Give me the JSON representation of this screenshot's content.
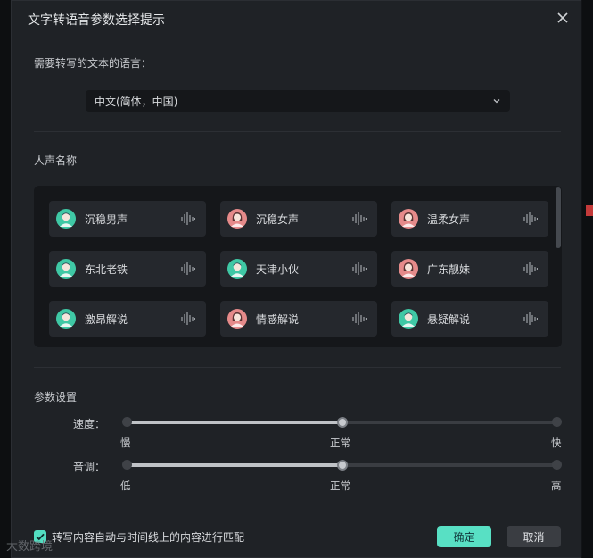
{
  "dialog": {
    "title": "文字转语音参数选择提示",
    "language_label": "需要转写的文本的语言：",
    "language_value": "中文(简体，中国)",
    "voice_label": "人声名称",
    "params_label": "参数设置"
  },
  "voices": [
    {
      "name": "沉稳男声",
      "gender": "male"
    },
    {
      "name": "沉稳女声",
      "gender": "female"
    },
    {
      "name": "温柔女声",
      "gender": "female"
    },
    {
      "name": "东北老铁",
      "gender": "male"
    },
    {
      "name": "天津小伙",
      "gender": "male"
    },
    {
      "name": "广东靓妹",
      "gender": "female"
    },
    {
      "name": "激昂解说",
      "gender": "male"
    },
    {
      "name": "情感解说",
      "gender": "female"
    },
    {
      "name": "悬疑解说",
      "gender": "male"
    }
  ],
  "sliders": {
    "speed": {
      "label": "速度：",
      "min_label": "慢",
      "mid_label": "正常",
      "max_label": "快",
      "value_fraction": 0.5
    },
    "pitch": {
      "label": "音调：",
      "min_label": "低",
      "mid_label": "正常",
      "max_label": "高",
      "value_fraction": 0.5
    }
  },
  "footer": {
    "checkbox_label": "转写内容自动与时间线上的内容进行匹配",
    "checkbox_checked": true,
    "ok_label": "确定",
    "cancel_label": "取消"
  },
  "watermark": "大数跨境",
  "colors": {
    "accent": "#58e0c4",
    "male_avatar": "#3fc8a5",
    "female_avatar": "#e58a8a"
  },
  "icons": {
    "close": "close-icon",
    "dropdown": "chevron-down-icon",
    "male_avatar": "male-avatar-icon",
    "female_avatar": "female-avatar-icon",
    "wave": "sound-wave-icon",
    "check": "check-icon"
  }
}
